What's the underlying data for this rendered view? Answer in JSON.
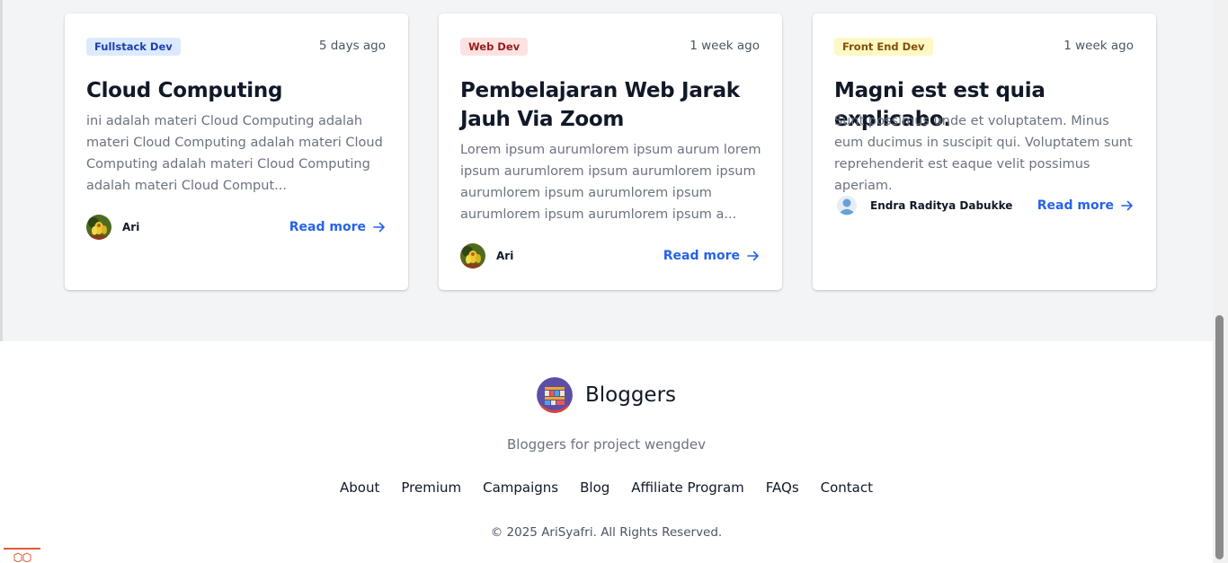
{
  "cards": [
    {
      "tag": "Fullstack Dev",
      "tag_colors": {
        "bg": "#dbeafe",
        "fg": "#1e40af"
      },
      "time": "5 days ago",
      "title": "Cloud Computing",
      "excerpt": "ini adalah materi Cloud Computing adalah materi Cloud Computing adalah materi Cloud Computing adalah materi Cloud Computing adalah materi Cloud Comput...",
      "author": "Ari",
      "avatar_icon": "flower-photo-avatar",
      "read_more": "Read more"
    },
    {
      "tag": "Web Dev",
      "tag_colors": {
        "bg": "#fee2e2",
        "fg": "#991b1b"
      },
      "time": "1 week ago",
      "title": "Pembelajaran Web Jarak Jauh Via Zoom",
      "excerpt": "Lorem ipsum aurumlorem ipsum aurum lorem ipsum aurumlorem ipsum aurumlorem ipsum aurumlorem ipsum aurumlorem ipsum aurumlorem ipsum aurumlorem ipsum a...",
      "author": "Ari",
      "avatar_icon": "flower-photo-avatar",
      "read_more": "Read more"
    },
    {
      "tag": "Front End Dev",
      "tag_colors": {
        "bg": "#fef9c3",
        "fg": "#854d0e"
      },
      "time": "1 week ago",
      "title": "Magni est est quia explicabo.",
      "excerpt": "Sunt possimus unde et voluptatem. Minus eum ducimus in suscipit qui. Voluptatem sunt reprehenderit est eaque velit possimus aperiam.",
      "author": "Endra Raditya Dabukke",
      "avatar_icon": "default-user-avatar",
      "read_more": "Read more"
    }
  ],
  "footer": {
    "brand": "Bloggers",
    "brand_icon": "bookshelf-logo",
    "tagline": "Bloggers for project wengdev",
    "links": [
      "About",
      "Premium",
      "Campaigns",
      "Blog",
      "Affiliate Program",
      "FAQs",
      "Contact"
    ],
    "copyright": "© 2025 AriSyafri. All Rights Reserved."
  },
  "colors": {
    "accent": "#2563eb",
    "band_bg": "#f3f4f6"
  }
}
